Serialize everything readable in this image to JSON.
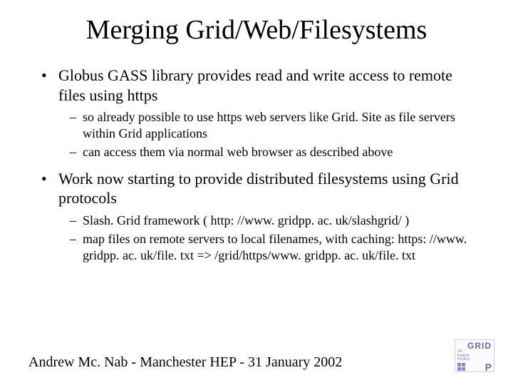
{
  "title": "Merging Grid/Web/Filesystems",
  "bullets": [
    {
      "text": "Globus GASS library provides read and write access to remote files using https",
      "sub": [
        "so already possible to use https web servers like Grid. Site as file servers within Grid applications",
        "can access them via normal web browser as described above"
      ]
    },
    {
      "text": "Work now starting to provide distributed filesystems using Grid protocols",
      "sub": [
        "Slash. Grid framework ( http: //www. gridpp. ac. uk/slashgrid/ )",
        "map files on remote servers to local filenames, with caching: https: //www. gridpp. ac. uk/file. txt => /grid/https/www. gridpp. ac. uk/file. txt"
      ]
    }
  ],
  "footer": "Andrew Mc. Nab - Manchester HEP - 31 January 2002",
  "logo": {
    "grid": "GRID",
    "line1": "UK",
    "line2": "Particle",
    "line3": "Physics",
    "p": "P"
  }
}
